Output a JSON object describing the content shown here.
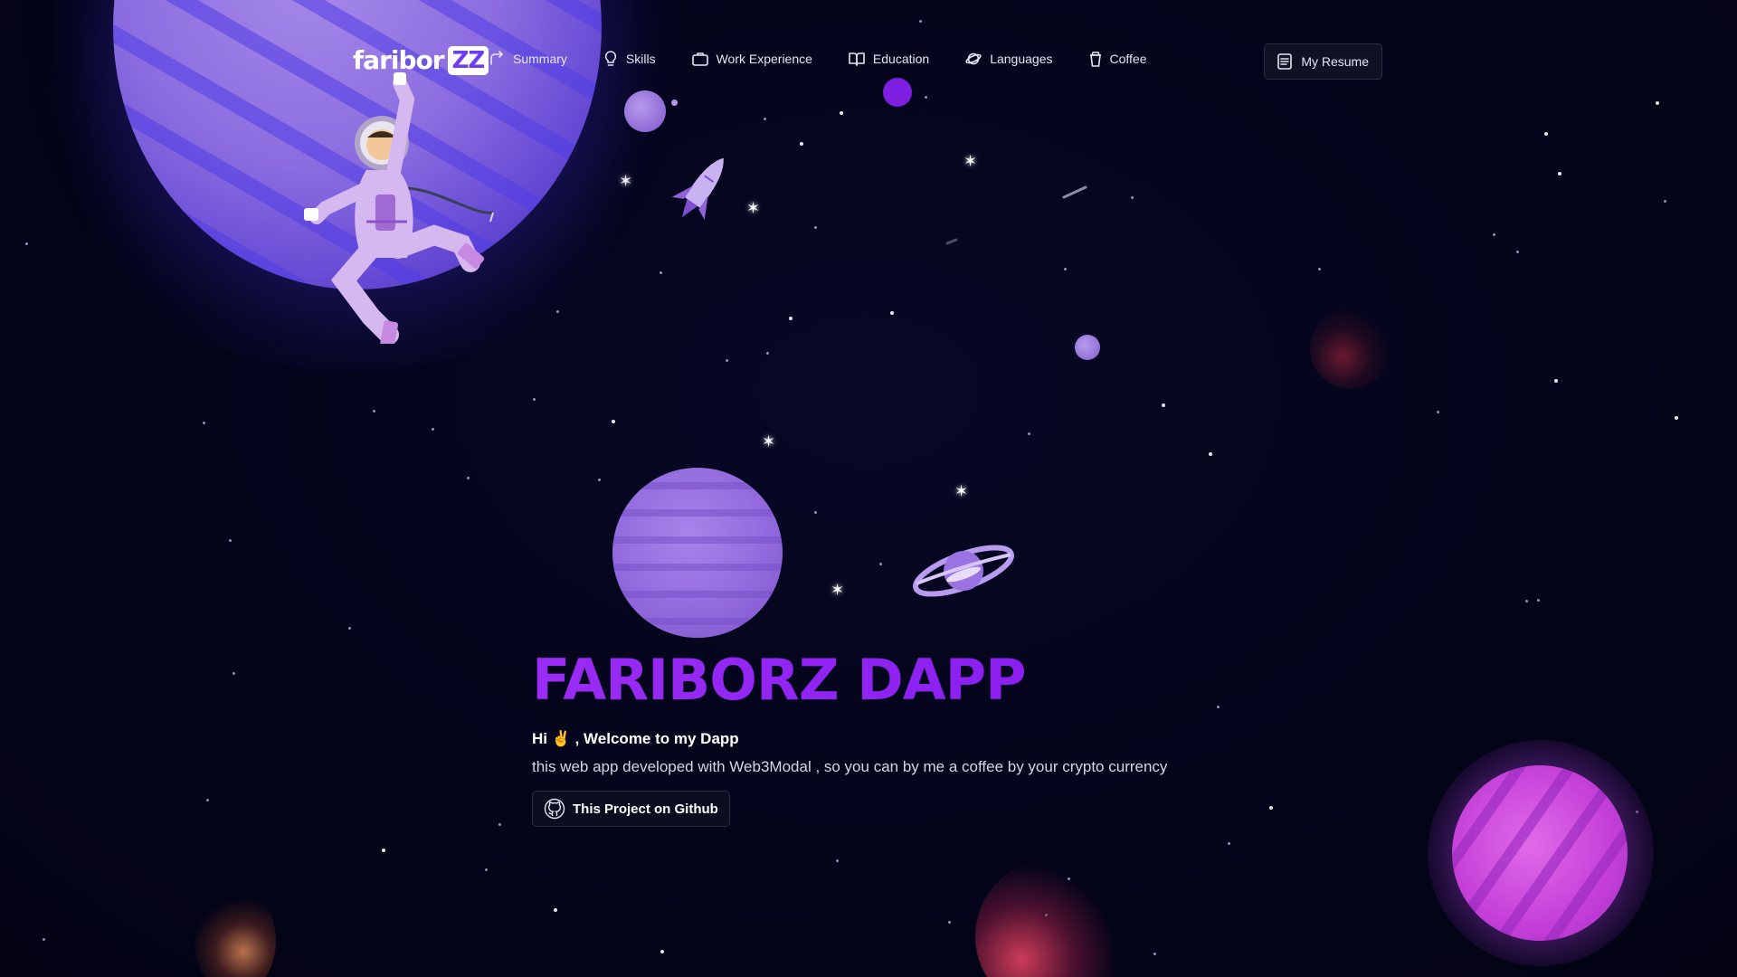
{
  "nav": {
    "logo_text": "faribor",
    "logo_badge": "ZZ",
    "items": [
      {
        "label": "Summary",
        "icon": "share-arrow-icon"
      },
      {
        "label": "Skills",
        "icon": "lightbulb-icon"
      },
      {
        "label": "Work Experience",
        "icon": "briefcase-icon"
      },
      {
        "label": "Education",
        "icon": "book-open-icon"
      },
      {
        "label": "Languages",
        "icon": "planet-icon"
      },
      {
        "label": "Coffee",
        "icon": "coffee-cup-icon"
      }
    ],
    "resume_label": "My Resume",
    "resume_icon": "document-icon"
  },
  "hero": {
    "title": "FARIBORZ DAPP",
    "greeting": "Hi ✌️ , Welcome to my Dapp",
    "description": "this web app developed with Web3Modal , so you can by me a coffee by your crypto currency",
    "github_label": "This Project on Github",
    "github_icon": "github-icon"
  },
  "colors": {
    "background": "#04041a",
    "title_accent": "#8a1ff5",
    "planet_purple": "#9168dc",
    "planet_pink": "#c43fd8"
  }
}
